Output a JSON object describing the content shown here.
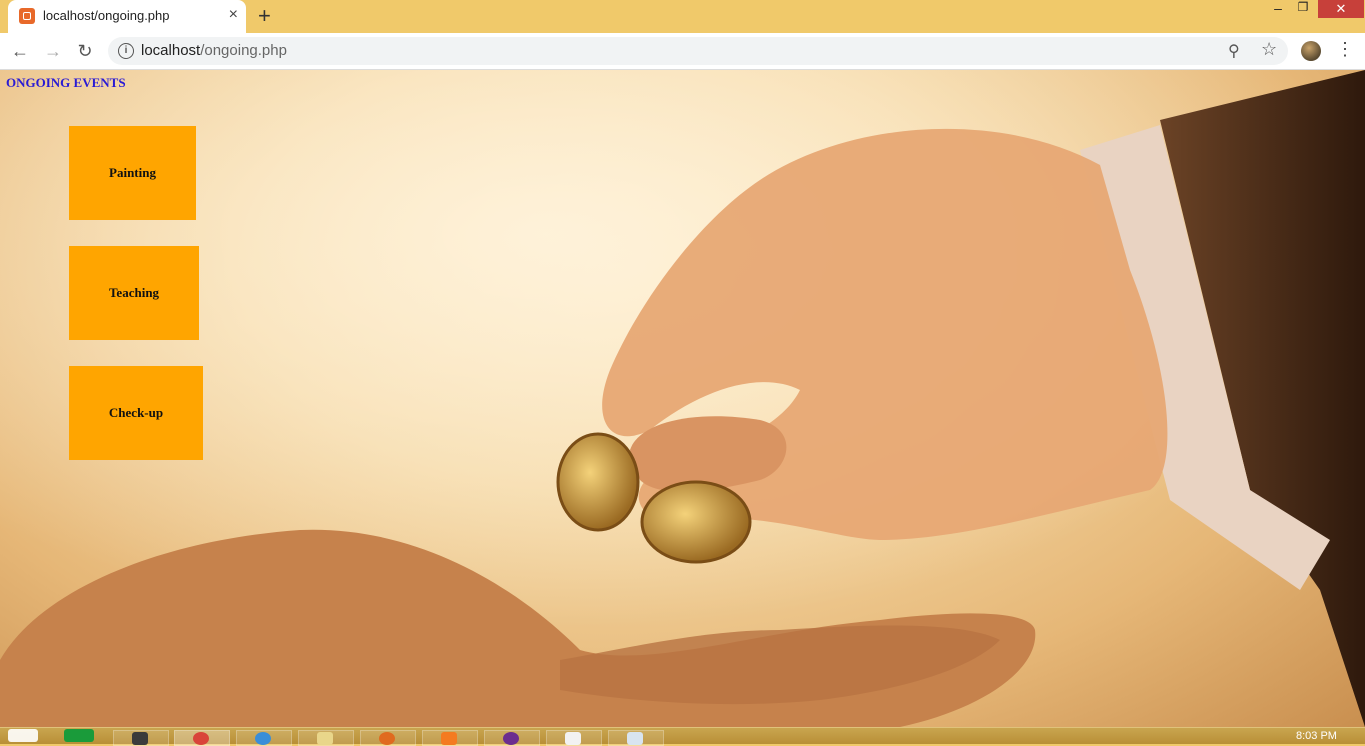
{
  "browser": {
    "tab_title": "localhost/ongoing.php",
    "tab_close": "×",
    "new_tab": "+",
    "url_host": "localhost",
    "url_path": "/ongoing.php",
    "window_controls": {
      "minimize": "‒",
      "maximize": "❐",
      "close": "✕"
    }
  },
  "page": {
    "heading": "ONGOING EVENTS",
    "events": [
      {
        "label": "Painting"
      },
      {
        "label": "Teaching"
      },
      {
        "label": "Check-up"
      }
    ],
    "colors": {
      "heading": "#2a1bd4",
      "event_button": "#ffa500"
    }
  },
  "taskbar": {
    "clock": "8:03 PM",
    "apps": [
      "start-icon",
      "store-icon",
      "media-icon",
      "chrome-icon",
      "ie-icon",
      "explorer-icon",
      "firefox-icon",
      "xampp-icon",
      "app-icon",
      "notepad-icon",
      "files-icon"
    ]
  }
}
